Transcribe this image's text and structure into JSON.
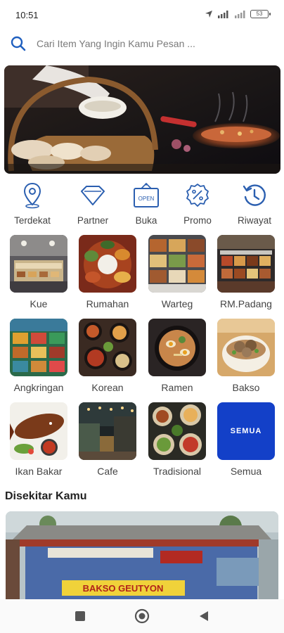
{
  "status_bar": {
    "time": "10:51",
    "battery": "53"
  },
  "search": {
    "placeholder": "Cari Item Yang Ingin Kamu Pesan ..."
  },
  "quick_menu": [
    {
      "label": "Terdekat",
      "icon": "location-pin-icon"
    },
    {
      "label": "Partner",
      "icon": "diamond-icon"
    },
    {
      "label": "Buka",
      "icon": "open-sign-icon",
      "sign_text": "OPEN"
    },
    {
      "label": "Promo",
      "icon": "percent-badge-icon"
    },
    {
      "label": "Riwayat",
      "icon": "history-clock-icon"
    }
  ],
  "categories": [
    {
      "label": "Kue"
    },
    {
      "label": "Rumahan"
    },
    {
      "label": "Warteg"
    },
    {
      "label": "RM.Padang"
    },
    {
      "label": "Angkringan"
    },
    {
      "label": "Korean"
    },
    {
      "label": "Ramen"
    },
    {
      "label": "Bakso"
    },
    {
      "label": "Ikan Bakar"
    },
    {
      "label": "Cafe"
    },
    {
      "label": "Tradisional"
    },
    {
      "label": "Semua",
      "tile_text": "SEMUA"
    }
  ],
  "nearby": {
    "title": "Disekitar Kamu",
    "sign_text": "BAKSO GEUTYON"
  },
  "colors": {
    "accent": "#1f5fbf",
    "icon_blue": "#2b5fb0",
    "semua_tile": "#1340c8"
  }
}
